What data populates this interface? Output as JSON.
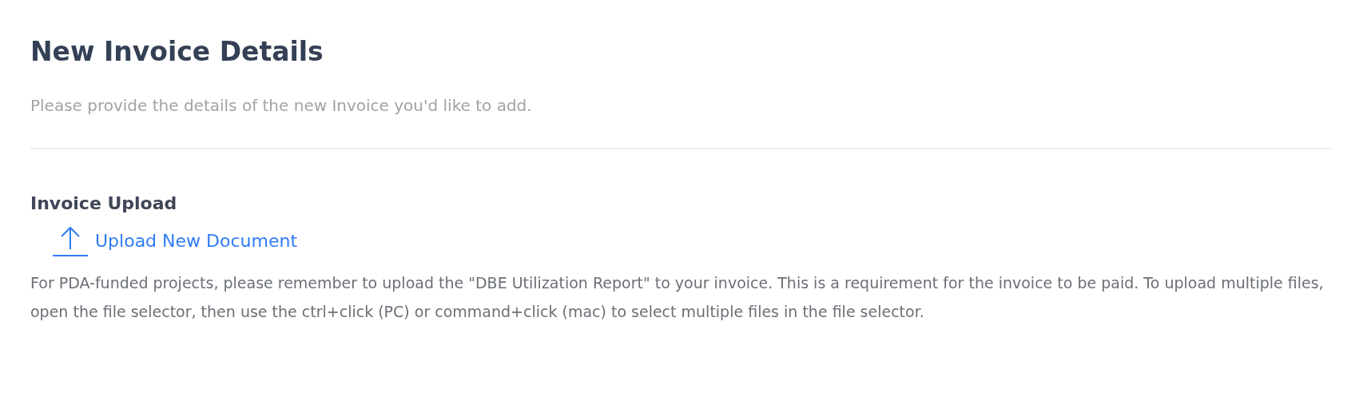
{
  "title": "New Invoice Details",
  "subtitle": "Please provide the details of the new Invoice you'd like to add.",
  "section": {
    "heading": "Invoice Upload",
    "upload_link": "Upload New Document",
    "note": "For PDA-funded projects, please remember to upload the \"DBE Utilization Report\" to your invoice. This is a requirement for the invoice to be paid. To upload multiple files, open the file selector, then use the ctrl+click (PC) or command+click (mac) to select multiple files in the file selector."
  }
}
